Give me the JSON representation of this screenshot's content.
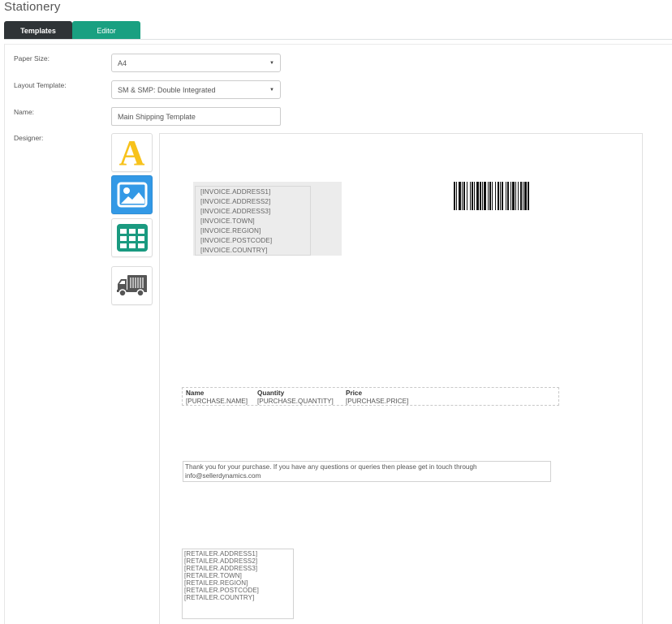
{
  "page": {
    "title": "Stationery"
  },
  "tabs": [
    {
      "label": "Templates",
      "active": false
    },
    {
      "label": "Editor",
      "active": true
    }
  ],
  "form": {
    "paper_size": {
      "label": "Paper Size:",
      "value": "A4"
    },
    "layout_template": {
      "label": "Layout Template:",
      "value": "SM & SMP: Double Integrated"
    },
    "name": {
      "label": "Name:",
      "value": "Main Shipping Template"
    },
    "designer": {
      "label": "Designer:"
    }
  },
  "toolbox": [
    {
      "name": "text-tool",
      "icon": "letter-a-icon",
      "glyph": "A",
      "color": "#f7c21b"
    },
    {
      "name": "image-tool",
      "icon": "picture-icon",
      "color": "#3399e6"
    },
    {
      "name": "table-tool",
      "icon": "table-grid-icon",
      "color": "#1a9a80"
    },
    {
      "name": "shipping-tool",
      "icon": "delivery-truck-icon",
      "color": "#555555"
    }
  ],
  "canvas": {
    "invoice_address": [
      "[INVOICE.ADDRESS1]",
      "[INVOICE.ADDRESS2]",
      "[INVOICE.ADDRESS3]",
      "[INVOICE.TOWN]",
      "[INVOICE.REGION]",
      "[INVOICE.POSTCODE]",
      "[INVOICE.COUNTRY]"
    ],
    "barcode": {
      "icon": "barcode-icon"
    },
    "purchase_table": {
      "headers": [
        "Name",
        "Quantity",
        "Price"
      ],
      "row": [
        "[PURCHASE.NAME]",
        "[PURCHASE.QUANTITY]",
        "[PURCHASE.PRICE]"
      ]
    },
    "thanks_line1": "Thank you for your purchase. If you have any questions or queries then please get in touch through",
    "thanks_line2": "info@sellerdynamics.com",
    "retailer_address": [
      "[RETAILER.ADDRESS1]",
      "[RETAILER.ADDRESS2]",
      "[RETAILER.ADDRESS3]",
      "[RETAILER.TOWN]",
      "[RETAILER.REGION]",
      "[RETAILER.POSTCODE]",
      "[RETAILER.COUNTRY]"
    ]
  },
  "colors": {
    "tab_dark": "#2f3437",
    "tab_accent": "#19a081",
    "image_tool_blue": "#3399e6",
    "text_tool_yellow": "#f7c21b"
  }
}
